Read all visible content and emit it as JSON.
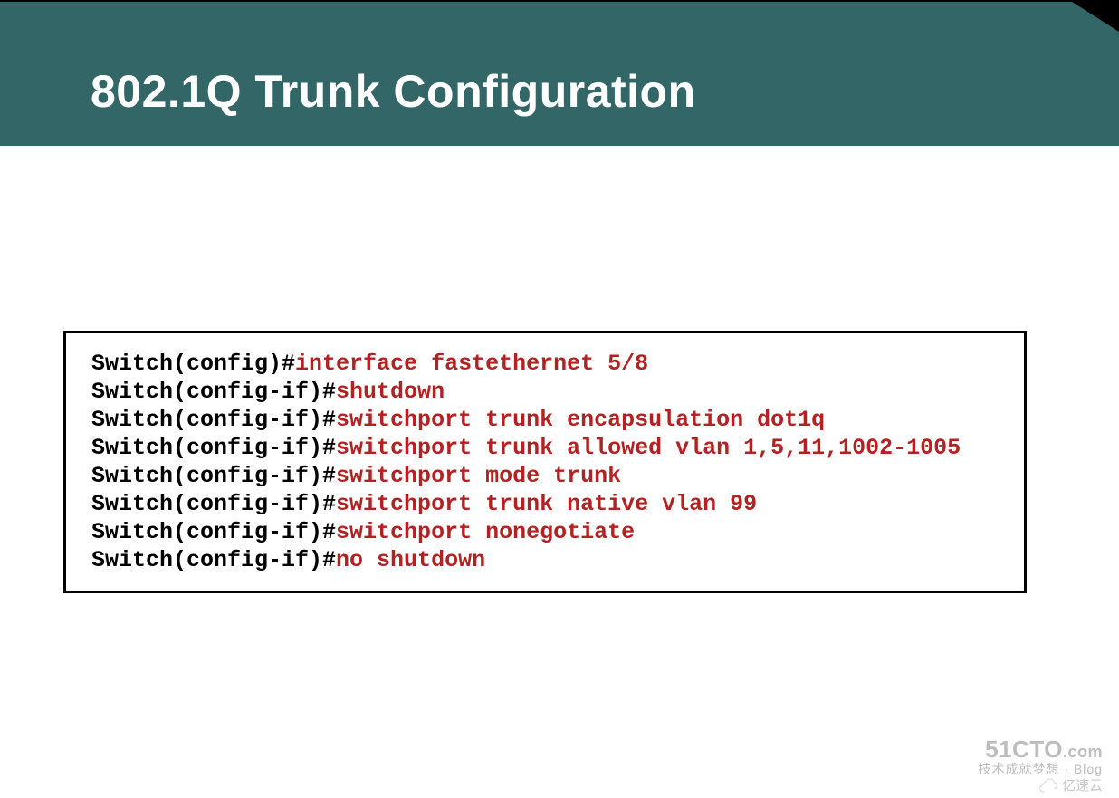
{
  "slide": {
    "title": "802.1Q Trunk Configuration"
  },
  "config": {
    "lines": [
      {
        "prompt": "Switch(config)#",
        "cmd": "interface fastethernet 5/8"
      },
      {
        "prompt": "Switch(config-if)#",
        "cmd": "shutdown"
      },
      {
        "prompt": "Switch(config-if)#",
        "cmd": "switchport trunk encapsulation dot1q"
      },
      {
        "prompt": "Switch(config-if)#",
        "cmd": "switchport trunk allowed vlan 1,5,11,1002-1005"
      },
      {
        "prompt": "Switch(config-if)#",
        "cmd": "switchport mode trunk"
      },
      {
        "prompt": "Switch(config-if)#",
        "cmd": "switchport trunk native vlan 99"
      },
      {
        "prompt": "Switch(config-if)#",
        "cmd": "switchport nonegotiate"
      },
      {
        "prompt": "Switch(config-if)#",
        "cmd": "no shutdown"
      }
    ]
  },
  "watermarks": {
    "cto_main": "51CTO",
    "cto_dot": ".com",
    "cto_sub": "技术成就梦想 · Blog",
    "yisu": "亿速云"
  }
}
